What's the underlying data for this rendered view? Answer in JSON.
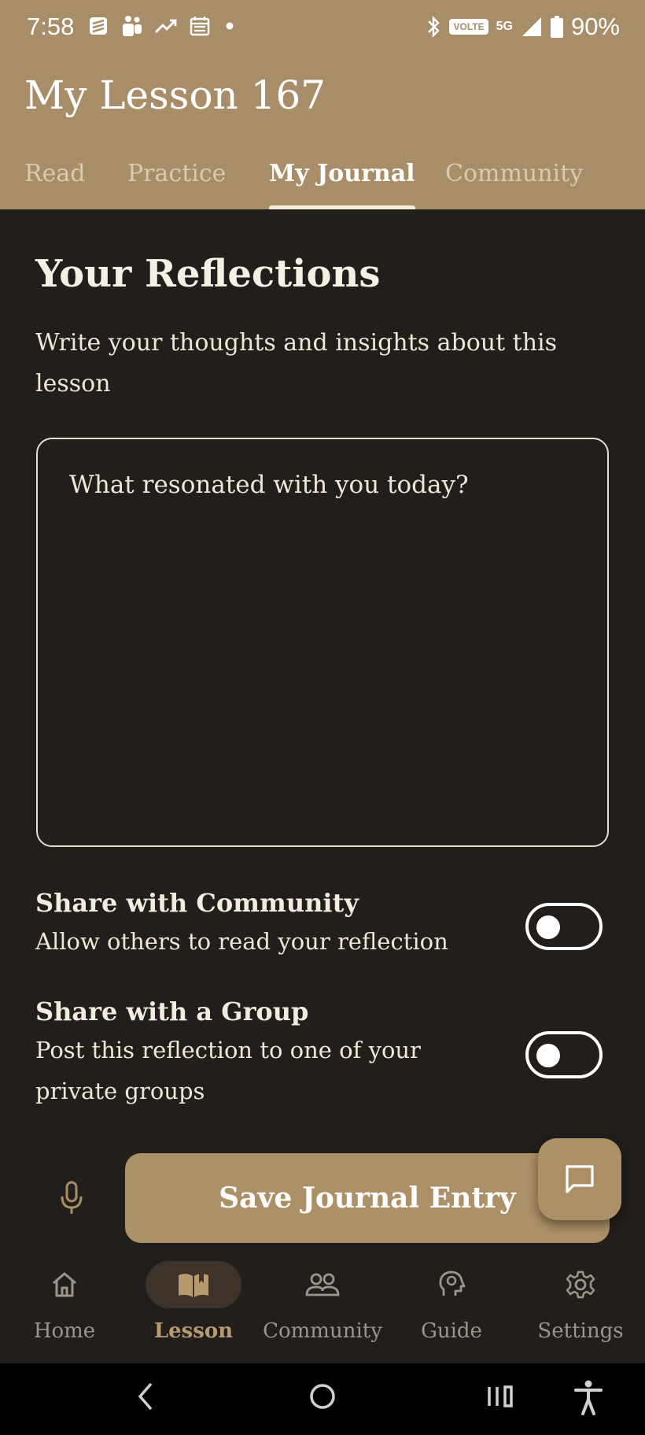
{
  "status_bar": {
    "time": "7:58",
    "volte": "VOLTE",
    "network": "5G",
    "battery": "90%"
  },
  "header": {
    "title": "My Lesson 167",
    "tabs": [
      {
        "label": "Read",
        "active": false
      },
      {
        "label": "Practice",
        "active": false
      },
      {
        "label": "My Journal",
        "active": true
      },
      {
        "label": "Community",
        "active": false
      }
    ]
  },
  "journal": {
    "title": "Your Reflections",
    "subtitle": "Write your thoughts and insights about this lesson",
    "placeholder": "What resonated with you today?",
    "value": ""
  },
  "share_community": {
    "title": "Share with Community",
    "description": "Allow others to read your reflection",
    "enabled": false
  },
  "share_group": {
    "title": "Share with a Group",
    "description": "Post this reflection to one of your private groups",
    "enabled": false
  },
  "actions": {
    "save_label": "Save Journal Entry"
  },
  "bottom_nav": [
    {
      "label": "Home",
      "icon": "home-icon",
      "active": false
    },
    {
      "label": "Lesson",
      "icon": "book-icon",
      "active": true
    },
    {
      "label": "Community",
      "icon": "people-icon",
      "active": false
    },
    {
      "label": "Guide",
      "icon": "head-icon",
      "active": false
    },
    {
      "label": "Settings",
      "icon": "gear-icon",
      "active": false
    }
  ],
  "colors": {
    "header_bg": "#a88d69",
    "page_bg": "#221e1b",
    "accent": "#ac9068",
    "active_nav_label": "#b79a6e"
  }
}
